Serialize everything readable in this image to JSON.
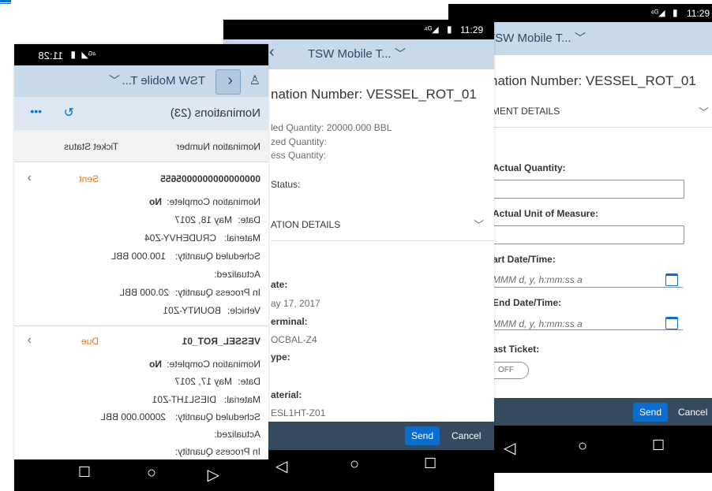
{
  "top_accent": {
    "color": "#0a6ed1"
  },
  "phone_left": {
    "status_time": "11:28",
    "app_title": "TSW Mobile T...",
    "list_title": "Nominations (23)",
    "col_headers": [
      "Nomination Number",
      "Ticket Status"
    ],
    "items": [
      {
        "number": "0000000000000005655",
        "status": "Sent",
        "fields": [
          {
            "label": "Nomination Complete:",
            "value": "No",
            "bold": true
          },
          {
            "label": "Date:",
            "value": "May 18, 2017"
          },
          {
            "label": "Material:",
            "value": "CRUDEHVY-Z04"
          },
          {
            "label": "Scheduled Quantity:",
            "value": "100.000 BBL"
          },
          {
            "label": "Actualized:",
            "value": ""
          },
          {
            "label": "In Process Quantity:",
            "value": "20.000 BBL"
          },
          {
            "label": "Vehicle:",
            "value": "BOUNTY-Z01"
          }
        ]
      },
      {
        "number": "VESSEL_ROT_01",
        "status": "Due",
        "fields": [
          {
            "label": "Nomination Complete:",
            "value": "No",
            "bold": true
          },
          {
            "label": "Date:",
            "value": "May 17, 2017"
          },
          {
            "label": "Material:",
            "value": "DIESL1HT-Z01"
          },
          {
            "label": "Scheduled Quantity:",
            "value": "20000.000 BBL"
          },
          {
            "label": "Actualized:",
            "value": ""
          },
          {
            "label": "In Process Quantity:",
            "value": ""
          }
        ]
      }
    ]
  },
  "phone_middle": {
    "status_time": "11:29",
    "app_title": "TSW Mobile T...",
    "nomination_number": "nation Number: VESSEL_ROT_01",
    "scheduled_quantity": "led Quantity: 20000.000 BBL",
    "actualized_quantity": "zed Quantity:",
    "in_process_quantity": "ess Quantity:",
    "status_label": "Status:",
    "section_title": "ATION DETAILS",
    "date_label": "ate:",
    "date_value": "ay 17, 2017",
    "terminal_label": "erminal:",
    "terminal_value": "OCBAL-Z4",
    "type_label": "ype:",
    "material_label": "aterial:",
    "material_value": "ESL1HT-Z01",
    "send_label": "Send",
    "cancel_label": "Cancel"
  },
  "phone_right": {
    "status_time": "11:29",
    "app_title": "TSW Mobile T...",
    "nomination_number": "nation Number: VESSEL_ROT_01",
    "section_title": "MENT DETAILS",
    "actual_quantity_label": "Actual Quantity:",
    "actual_uom_label": "Actual Unit of Measure:",
    "start_label": "art Date/Time:",
    "start_placeholder": "MMM d, y, h:mm:ss a",
    "end_label": "End Date/Time:",
    "end_placeholder": "MMM d, y, h:mm:ss a",
    "last_ticket_label": "ast Ticket:",
    "toggle_label": "OFF",
    "send_label": "Send",
    "cancel_label": "Cancel"
  }
}
